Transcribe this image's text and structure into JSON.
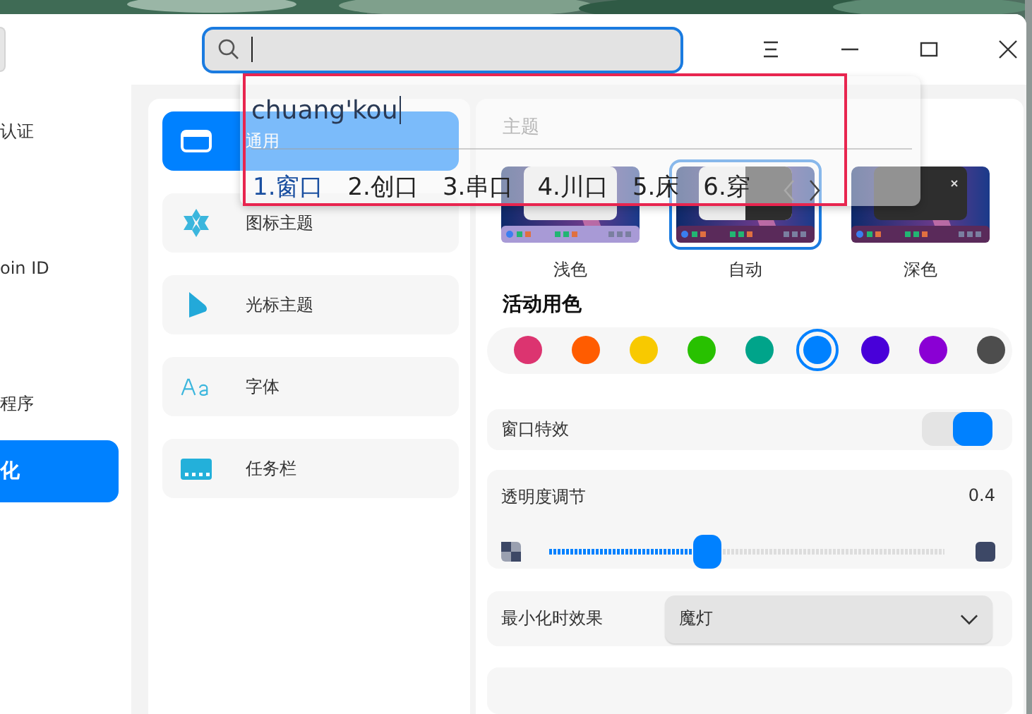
{
  "sidebar": {
    "items": [
      {
        "label": "认证",
        "selected": false
      },
      {
        "label": "oin ID",
        "selected": false
      },
      {
        "label": "程序",
        "selected": false
      },
      {
        "label": "化",
        "selected": true
      }
    ]
  },
  "search": {
    "focused": true
  },
  "categories": [
    {
      "label": "通用",
      "selected": true
    },
    {
      "label": "图标主题",
      "selected": false
    },
    {
      "label": "光标主题",
      "selected": false
    },
    {
      "label": "字体",
      "selected": false
    },
    {
      "label": "任务栏",
      "selected": false
    }
  ],
  "ime": {
    "input": "chuang'kou",
    "candidates": [
      {
        "label": "1.窗口",
        "selected": true
      },
      {
        "label": "2.创口",
        "selected": false
      },
      {
        "label": "3.串口",
        "selected": false
      },
      {
        "label": "4.川口",
        "selected": false
      },
      {
        "label": "5.床",
        "selected": false
      },
      {
        "label": "6.穿",
        "selected": false
      }
    ]
  },
  "theme": {
    "heading": "主题",
    "options": [
      {
        "label": "浅色",
        "kind": "light",
        "selected": false
      },
      {
        "label": "自动",
        "kind": "auto",
        "selected": true
      },
      {
        "label": "深色",
        "kind": "dark",
        "selected": false
      }
    ]
  },
  "accent": {
    "heading": "活动用色",
    "colors": [
      {
        "color": "#dc3470",
        "selected": false
      },
      {
        "color": "#ff5c00",
        "selected": false
      },
      {
        "color": "#f8c900",
        "selected": false
      },
      {
        "color": "#28c100",
        "selected": false
      },
      {
        "color": "#00a48a",
        "selected": false
      },
      {
        "color": "#0081ff",
        "selected": true
      },
      {
        "color": "#4800d9",
        "selected": false
      },
      {
        "color": "#8a00d4",
        "selected": false
      },
      {
        "color": "#4d4d4d",
        "selected": false
      }
    ]
  },
  "window_effects": {
    "label": "窗口特效",
    "on": true
  },
  "transparency": {
    "label": "透明度调节",
    "reading": "0.4",
    "level": 0.4
  },
  "minimize": {
    "label": "最小化时效果",
    "value": "魔灯"
  }
}
